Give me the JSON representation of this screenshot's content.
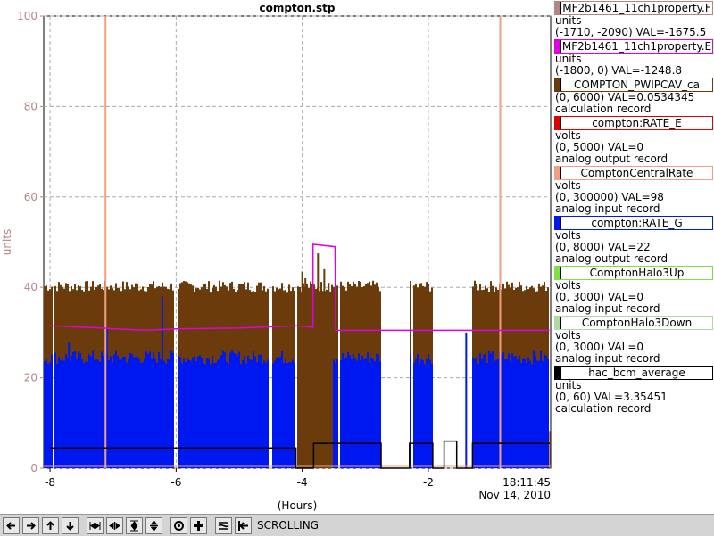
{
  "chart_data": {
    "type": "line",
    "title": "compton.stp",
    "xlabel": "(Hours)",
    "ylabel": "units",
    "xlim": [
      -8.1,
      -0.06
    ],
    "ylim": [
      0,
      100
    ],
    "grid": true,
    "x_ticks": [
      -8,
      -6,
      -4,
      -2
    ],
    "x_tick_labels": [
      "-8",
      "-6",
      "-4",
      "-2"
    ],
    "y_ticks": [
      0,
      20,
      40,
      60,
      80,
      100
    ],
    "y_tick_labels": [
      "0",
      "20",
      "40",
      "60",
      "80",
      "100"
    ],
    "time_label_time": "18:11:45",
    "time_label_date": "Nov 14, 2010",
    "legend_placement": "right",
    "data_gaps": [
      [
        -7.95,
        -7.92
      ],
      [
        -6.02,
        -5.99
      ],
      [
        -4.52,
        -4.49
      ],
      [
        -4.12,
        -4.07
      ],
      [
        -3.42,
        -3.4
      ],
      [
        -2.76,
        -2.3
      ],
      [
        -2.27,
        -2.25
      ],
      [
        -1.92,
        -1.3
      ]
    ],
    "series": [
      {
        "name": "MF2b1461_11ch1property.F",
        "color": "#b58585",
        "approx_value": 0.3,
        "spikes_x": [
          -7.12,
          -0.86
        ]
      },
      {
        "name": "MF2b1461_11ch1property.E",
        "color": "#e000e0",
        "x": [
          -8.0,
          -7.2,
          -6.5,
          -6.0,
          -5.0,
          -4.1,
          -3.83,
          -3.83,
          -3.48,
          -3.47,
          -2.5,
          -1.0,
          -0.08
        ],
        "y": [
          31.5,
          31.0,
          30.5,
          30.8,
          31.0,
          31.5,
          31.2,
          49.5,
          49.0,
          30.5,
          30.5,
          30.5,
          30.5
        ]
      },
      {
        "name": "COMPTON_PWIPCAV_ca",
        "color": "#6b3b0c",
        "band": [
          0,
          41
        ],
        "dense": true
      },
      {
        "name": "compton:RATE_E",
        "color": "#e00000",
        "approx_value": 0
      },
      {
        "name": "ComptonCentralRate",
        "color": "#f0a080",
        "approx_value": 0.5
      },
      {
        "name": "compton:RATE_G",
        "color": "#0018f0",
        "band": [
          0,
          26
        ],
        "dense": true,
        "tall_spikes": [
          [
            -6.22,
            38
          ],
          [
            -7.1,
            31
          ],
          [
            -7.7,
            28
          ],
          [
            -1.4,
            30
          ]
        ]
      },
      {
        "name": "ComptonHalo3Up",
        "color": "#80e040",
        "approx_value": 0
      },
      {
        "name": "ComptonHalo3Down",
        "color": "#b0d8a0",
        "approx_value": 0
      },
      {
        "name": "hac_bcm_average",
        "color": "#000000",
        "x": [
          -8.0,
          -5.0,
          -4.1,
          -4.1,
          -3.82,
          -3.82,
          -3.0,
          -2.75,
          -2.75,
          -2.3,
          -2.3,
          -1.93,
          -1.93,
          -1.75,
          -1.75,
          -1.55,
          -1.55,
          -1.3,
          -1.3,
          -0.08
        ],
        "y": [
          4.5,
          4.5,
          4.5,
          0,
          0,
          5.5,
          5.5,
          5.5,
          0,
          0,
          5.5,
          5.5,
          0,
          0,
          6,
          6,
          0,
          0,
          5.5,
          5.5
        ]
      }
    ]
  },
  "legend": [
    {
      "name": "MF2b1461_11ch1property.F",
      "color": "#b58585",
      "lines": [
        "units",
        "(-1710, -2090) VAL=-1675.5"
      ]
    },
    {
      "name": "MF2b1461_11ch1property.E",
      "color": "#e000e0",
      "lines": [
        "units",
        "(-1800, 0) VAL=-1248.8"
      ]
    },
    {
      "name": "COMPTON_PWIPCAV_ca",
      "color": "#6b3b0c",
      "lines": [
        "(0, 6000) VAL=0.0534345",
        "calculation record"
      ]
    },
    {
      "name": "compton:RATE_E",
      "color": "#e00000",
      "lines": [
        "volts",
        "(0, 5000) VAL=0",
        "analog output record"
      ]
    },
    {
      "name": "ComptonCentralRate",
      "color": "#f0a080",
      "lines": [
        "volts",
        "(0, 300000) VAL=98",
        "analog input record"
      ]
    },
    {
      "name": "compton:RATE_G",
      "color": "#0018f0",
      "lines": [
        "volts",
        "(0, 8000) VAL=22",
        "analog output record"
      ]
    },
    {
      "name": "ComptonHalo3Up",
      "color": "#80e040",
      "lines": [
        "volts",
        "(0, 3000) VAL=0",
        "analog input record"
      ]
    },
    {
      "name": "ComptonHalo3Down",
      "color": "#b0d8a0",
      "lines": [
        "volts",
        "(0, 3000) VAL=0",
        "analog input record"
      ]
    },
    {
      "name": "hac_bcm_average",
      "color": "#000000",
      "lines": [
        "units",
        "(0, 60) VAL=3.35451",
        "calculation record"
      ]
    }
  ],
  "toolbar": {
    "status": "SCROLLING",
    "buttons": [
      {
        "name": "scroll-left-icon"
      },
      {
        "name": "scroll-right-icon"
      },
      {
        "name": "scroll-up-icon"
      },
      {
        "name": "scroll-down-icon"
      },
      {
        "name": "zoom-in-x-icon"
      },
      {
        "name": "zoom-out-x-icon"
      },
      {
        "name": "zoom-in-y-icon"
      },
      {
        "name": "zoom-out-y-icon"
      },
      {
        "name": "autoscale-icon"
      },
      {
        "name": "add-pv-icon"
      },
      {
        "name": "plot-settings-icon"
      },
      {
        "name": "scroll-mode-icon"
      }
    ]
  }
}
